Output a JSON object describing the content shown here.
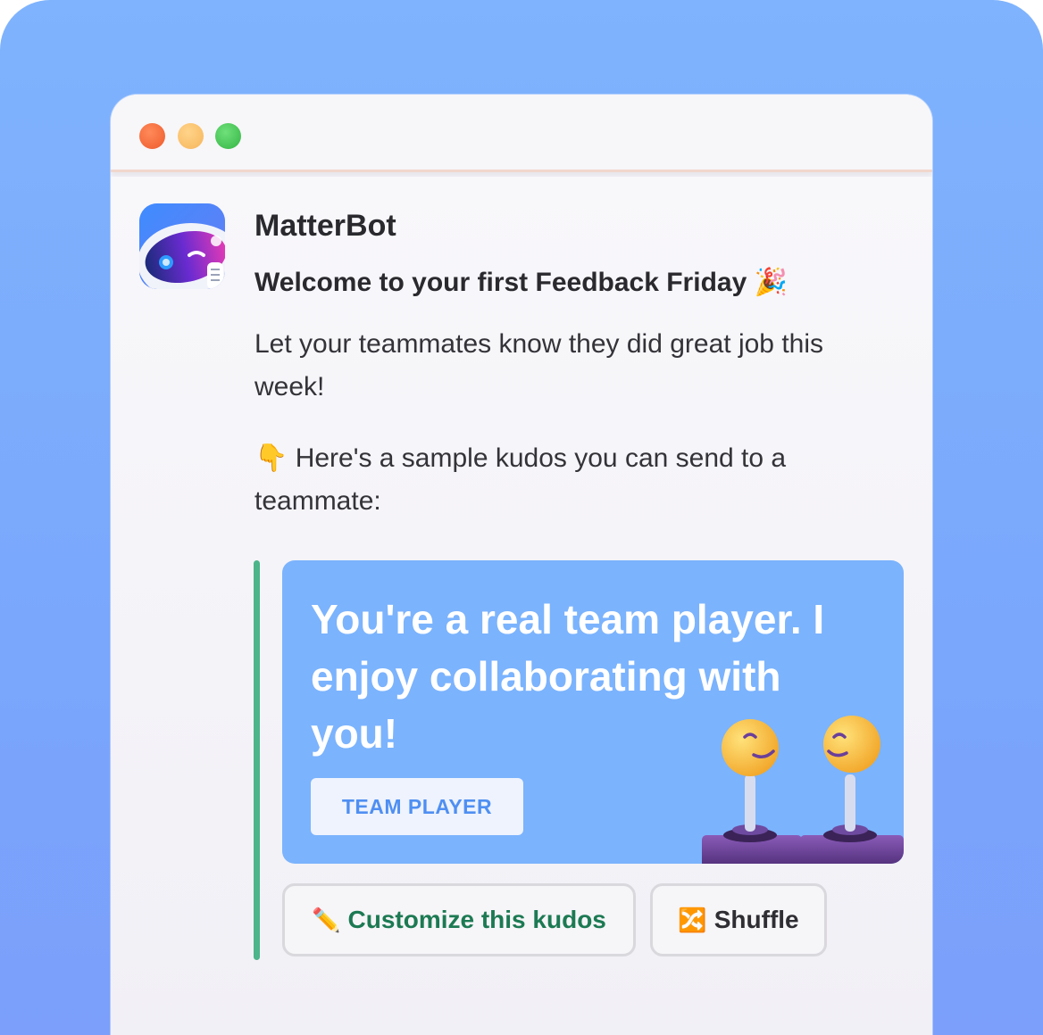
{
  "message": {
    "bot_name": "MatterBot",
    "welcome": "Welcome to your first Feedback Friday",
    "welcome_emoji": "🎉",
    "paragraph1": "Let your teammates know they did great job this week!",
    "paragraph2_emoji": "👇",
    "paragraph2": "Here's a sample kudos you can send to a teammate:"
  },
  "card": {
    "text": "You're a real team player. I enjoy collaborating with you!",
    "tag": "TEAM PLAYER"
  },
  "actions": {
    "customize_icon": "✏️",
    "customize_label": "Customize this kudos",
    "shuffle_icon": "🔀",
    "shuffle_label": "Shuffle"
  },
  "colors": {
    "background": "#7fb3fd",
    "card": "#7bb3fd",
    "accent_green": "#1c7a53",
    "quote_bar": "#4cb58a",
    "tag_text": "#4f8ff2"
  }
}
